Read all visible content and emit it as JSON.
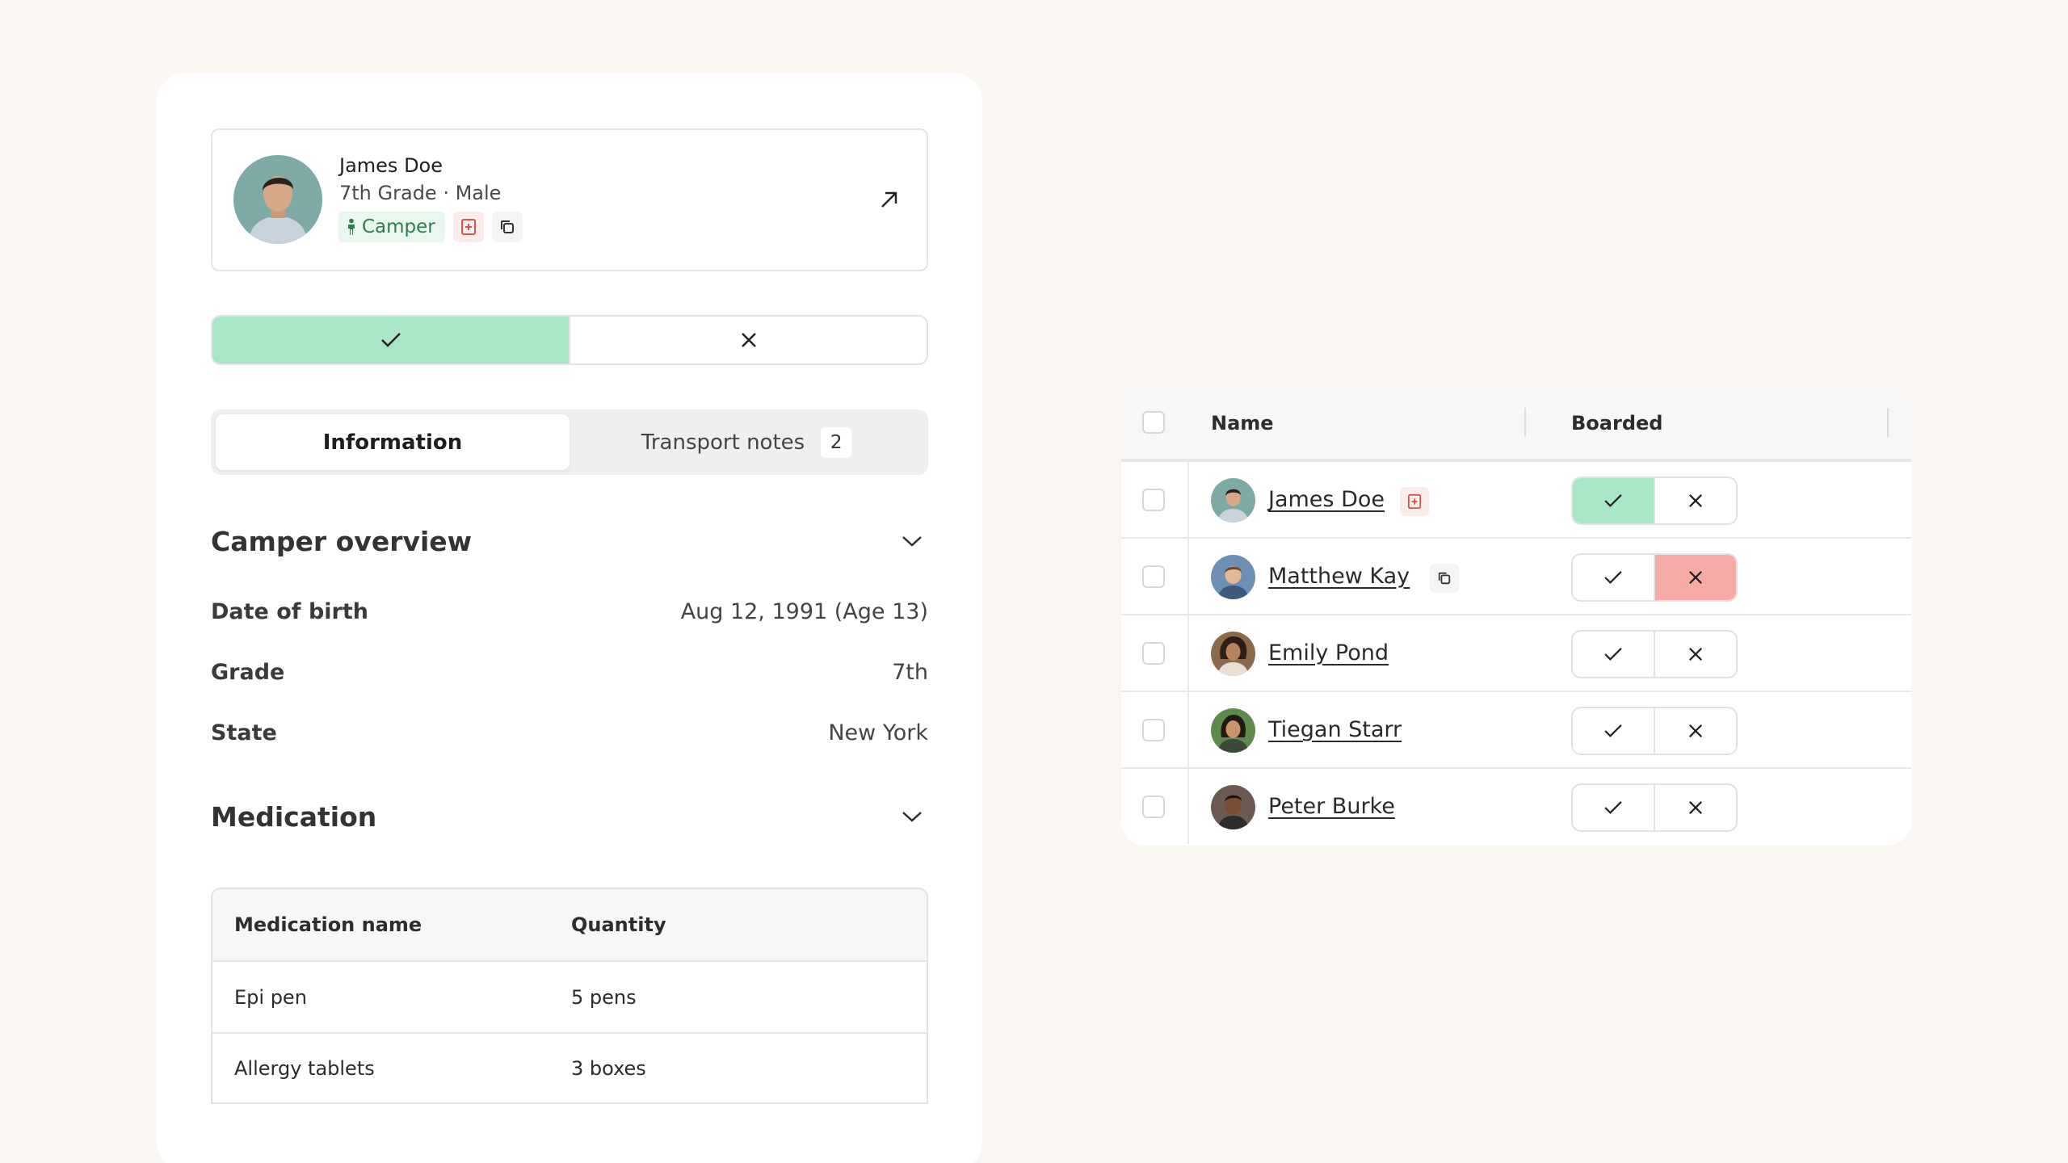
{
  "profile": {
    "name": "James Doe",
    "subtitle": "7th Grade · Male",
    "tag": "Camper"
  },
  "tabs": [
    {
      "label": "Information",
      "active": true
    },
    {
      "label": "Transport notes",
      "badge": "2",
      "active": false
    }
  ],
  "overview": {
    "title": "Camper overview",
    "fields": [
      {
        "label": "Date of birth",
        "value": "Aug 12, 1991 (Age 13)"
      },
      {
        "label": "Grade",
        "value": "7th"
      },
      {
        "label": "State",
        "value": "New York"
      }
    ]
  },
  "medication": {
    "title": "Medication",
    "columns": [
      "Medication name",
      "Quantity"
    ],
    "rows": [
      [
        "Epi pen",
        "5 pens"
      ],
      [
        "Allergy tablets",
        "3 boxes"
      ]
    ]
  },
  "boarding": {
    "columns": [
      "Name",
      "Boarded"
    ],
    "rows": [
      {
        "name": "James Doe",
        "chip": "medical",
        "status": "yes"
      },
      {
        "name": "Matthew Kay",
        "chip": "copy",
        "status": "no"
      },
      {
        "name": "Emily Pond",
        "status": "none"
      },
      {
        "name": "Tiegan Starr",
        "status": "none"
      },
      {
        "name": "Peter Burke",
        "status": "none"
      }
    ]
  },
  "colors": {
    "accent_green": "#a9e6c6",
    "accent_red": "#f5aaa6",
    "background": "#faf7f2"
  }
}
